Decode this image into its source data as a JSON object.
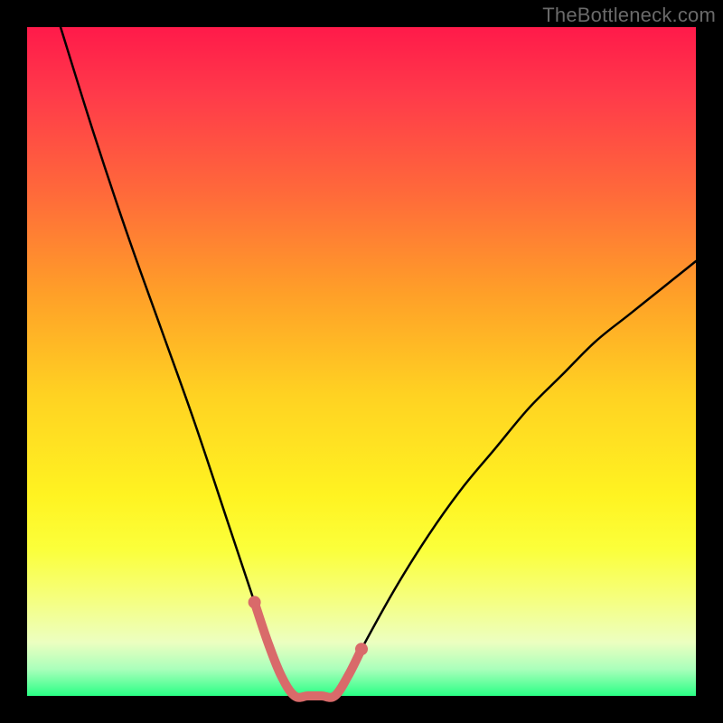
{
  "watermark": "TheBottleneck.com",
  "colors": {
    "background": "#000000",
    "curve_stroke": "#000000",
    "marker_stroke": "#d96a6a",
    "gradient_top": "#ff1a4a",
    "gradient_bottom": "#2aff85"
  },
  "chart_data": {
    "type": "line",
    "title": "",
    "xlabel": "",
    "ylabel": "",
    "xlim": [
      0,
      100
    ],
    "ylim": [
      0,
      100
    ],
    "grid": false,
    "series": [
      {
        "name": "curve",
        "x": [
          5,
          10,
          15,
          20,
          25,
          30,
          32,
          34,
          36,
          38,
          40,
          42,
          44,
          46,
          48,
          50,
          55,
          60,
          65,
          70,
          75,
          80,
          85,
          90,
          95,
          100
        ],
        "values": [
          100,
          84,
          69,
          55,
          41,
          26,
          20,
          14,
          8,
          3,
          0,
          0,
          0,
          0,
          3,
          7,
          16,
          24,
          31,
          37,
          43,
          48,
          53,
          57,
          61,
          65
        ]
      },
      {
        "name": "optimal-range-marker",
        "x": [
          34,
          36,
          38,
          40,
          42,
          44,
          46,
          48,
          50
        ],
        "values": [
          14,
          8,
          3,
          0,
          0,
          0,
          0,
          3,
          7
        ]
      }
    ]
  }
}
